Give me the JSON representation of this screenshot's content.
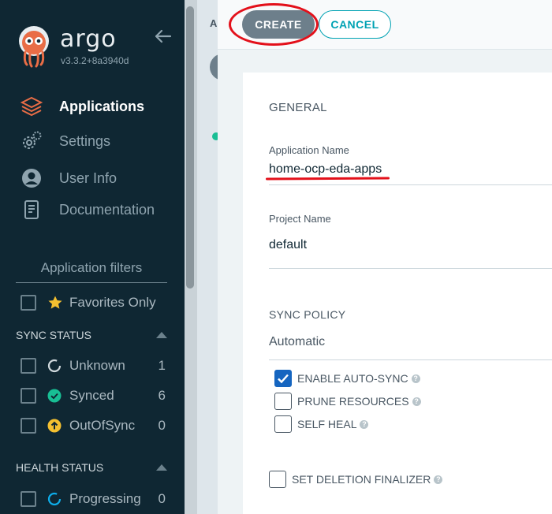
{
  "sidebar": {
    "brand": "argo",
    "version": "v3.3.2+8a3940d",
    "nav": [
      {
        "label": "Applications",
        "icon": "layers-icon"
      },
      {
        "label": "Settings",
        "icon": "gears-icon"
      },
      {
        "label": "User Info",
        "icon": "user-circle-icon"
      },
      {
        "label": "Documentation",
        "icon": "book-icon"
      }
    ],
    "filters_title": "Application filters",
    "favorites_label": "Favorites Only",
    "sync_status_header": "SYNC STATUS",
    "sync_status": [
      {
        "label": "Unknown",
        "count": "1"
      },
      {
        "label": "Synced",
        "count": "6"
      },
      {
        "label": "OutOfSync",
        "count": "0"
      }
    ],
    "health_status_header": "HEALTH STATUS",
    "health_status": [
      {
        "label": "Progressing",
        "count": "0"
      }
    ]
  },
  "background": {
    "header_letter": "A"
  },
  "toolbar": {
    "create_label": "CREATE",
    "cancel_label": "CANCEL"
  },
  "form": {
    "general_title": "GENERAL",
    "app_name_label": "Application Name",
    "app_name_value": "home-ocp-eda-apps",
    "project_label": "Project Name",
    "project_value": "default",
    "sync_policy_title": "SYNC POLICY",
    "sync_policy_value": "Automatic",
    "options": [
      {
        "label": "ENABLE AUTO-SYNC",
        "checked": true
      },
      {
        "label": "PRUNE RESOURCES",
        "checked": false
      },
      {
        "label": "SELF HEAL",
        "checked": false
      }
    ],
    "finalizer_label": "SET DELETION FINALIZER"
  },
  "colors": {
    "sidebar_bg": "#0f2733",
    "accent": "#00a2b3",
    "annotation_red": "#e3101a",
    "synced_green": "#18be94",
    "outofsync_yellow": "#f4c030"
  }
}
